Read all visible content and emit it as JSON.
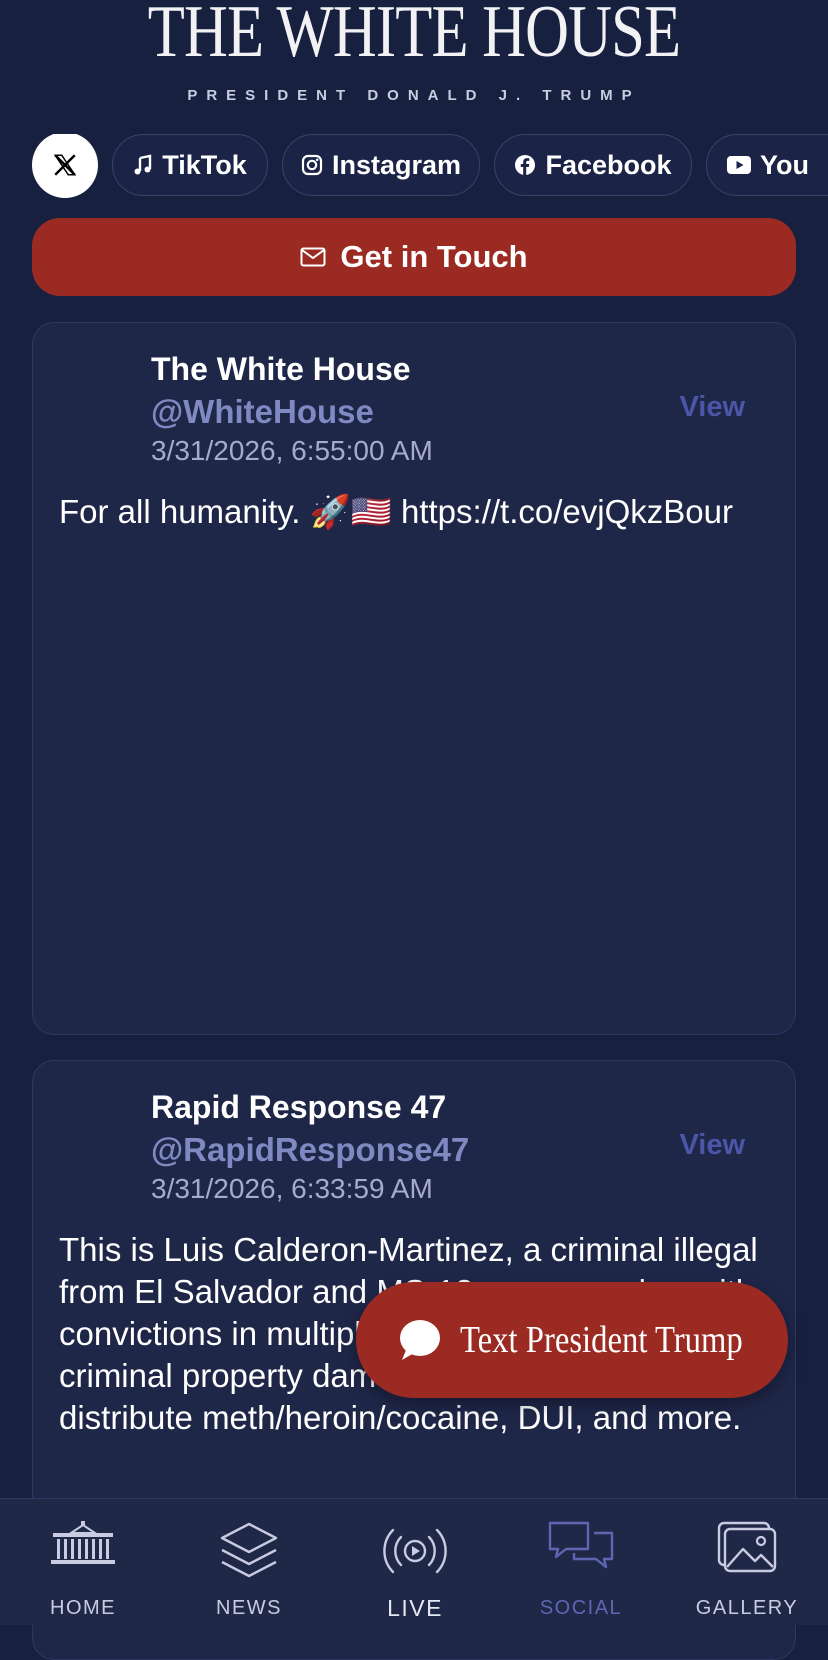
{
  "header": {
    "title": "THE WHITE HOUSE",
    "subtitle": "PRESIDENT DONALD J. TRUMP"
  },
  "social_links": [
    {
      "label": "",
      "icon": "x-logo-icon"
    },
    {
      "label": "TikTok",
      "icon": "music-note-icon"
    },
    {
      "label": "Instagram",
      "icon": "instagram-icon"
    },
    {
      "label": "Facebook",
      "icon": "facebook-icon"
    },
    {
      "label": "You",
      "icon": "youtube-icon"
    }
  ],
  "contact_button": {
    "label": "Get in Touch",
    "icon": "mail-icon"
  },
  "posts": [
    {
      "name": "The White House",
      "handle": "@WhiteHouse",
      "date": "3/31/2026, 6:55:00 AM",
      "view_label": "View",
      "text": "For all humanity. 🚀🇺🇸 https://t.co/evjQkzBour"
    },
    {
      "name": "Rapid Response 47",
      "handle": "@RapidResponse47",
      "date": "3/31/2026, 6:33:59 AM",
      "view_label": "View",
      "text": "This is Luis Calderon-Martinez, a criminal illegal from El Salvador and MS-13 gang member with convictions in multiple states for carjacking, criminal property damage, conspiracy to distribute meth/heroin/cocaine, DUI, and more."
    }
  ],
  "fab": {
    "label": "Text President Trump",
    "icon": "chat-bubble-icon"
  },
  "bottom_nav": [
    {
      "label": "HOME",
      "icon": "white-house-icon"
    },
    {
      "label": "NEWS",
      "icon": "layers-icon"
    },
    {
      "label": "LIVE",
      "icon": "broadcast-icon"
    },
    {
      "label": "SOCIAL",
      "icon": "chat-bubbles-icon",
      "active": true
    },
    {
      "label": "GALLERY",
      "icon": "gallery-icon"
    }
  ],
  "colors": {
    "background": "#182040",
    "card": "#1f2749",
    "accent_red": "#9a2a22",
    "handle": "#8089c2",
    "link": "#4b56a8",
    "active_nav": "#5e66b4"
  }
}
